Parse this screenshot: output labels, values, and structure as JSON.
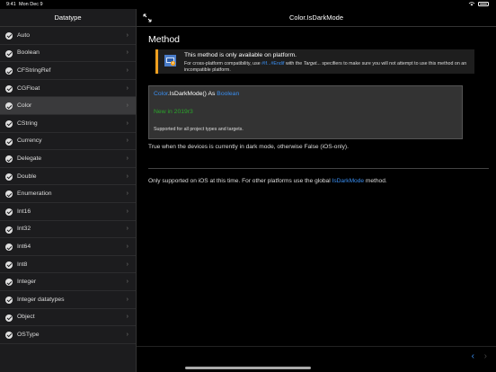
{
  "status": {
    "time": "9:41",
    "date": "Mon Dec 9"
  },
  "sidebar": {
    "title": "Datatype",
    "items": [
      {
        "label": "Auto"
      },
      {
        "label": "Boolean"
      },
      {
        "label": "CFStringRef"
      },
      {
        "label": "CGFloat"
      },
      {
        "label": "Color",
        "selected": true
      },
      {
        "label": "CString"
      },
      {
        "label": "Currency"
      },
      {
        "label": "Delegate"
      },
      {
        "label": "Double"
      },
      {
        "label": "Enumeration"
      },
      {
        "label": "Int16"
      },
      {
        "label": "Int32"
      },
      {
        "label": "Int64"
      },
      {
        "label": "Int8"
      },
      {
        "label": "Integer"
      },
      {
        "label": "Integer datatypes"
      },
      {
        "label": "Object"
      },
      {
        "label": "OSType"
      }
    ]
  },
  "main": {
    "title": "Color.IsDarkMode",
    "heading": "Method",
    "notice": {
      "title": "This method is only available on platform.",
      "body_prefix": "For cross-platform compatibility, use ",
      "body_link": "#If...#Endif",
      "body_mid1": " with the ",
      "body_target": "Target...",
      "body_suffix": " specifiers to make sure you will not attempt to use this method on an incompatible platform."
    },
    "code": {
      "class_name": "Color",
      "method": ".IsDarkMode",
      "parens": "() ",
      "as_kw": "As ",
      "return_type": "Boolean",
      "new_in": "New in 2019r3",
      "support": "Supported for all project types and targets."
    },
    "description": "True when the devices is currently in dark mode, otherwise False (iOS-only).",
    "note_prefix": "Only supported on iOS at this time. For other platforms use the global ",
    "note_link": "IsDarkMode",
    "note_suffix": " method."
  },
  "toolbar": {
    "back_glyph": "‹",
    "forward_glyph": "›"
  },
  "colors": {
    "accent": "#3a8ef0",
    "warning": "#f0a020",
    "new_green": "#2aa52a"
  }
}
